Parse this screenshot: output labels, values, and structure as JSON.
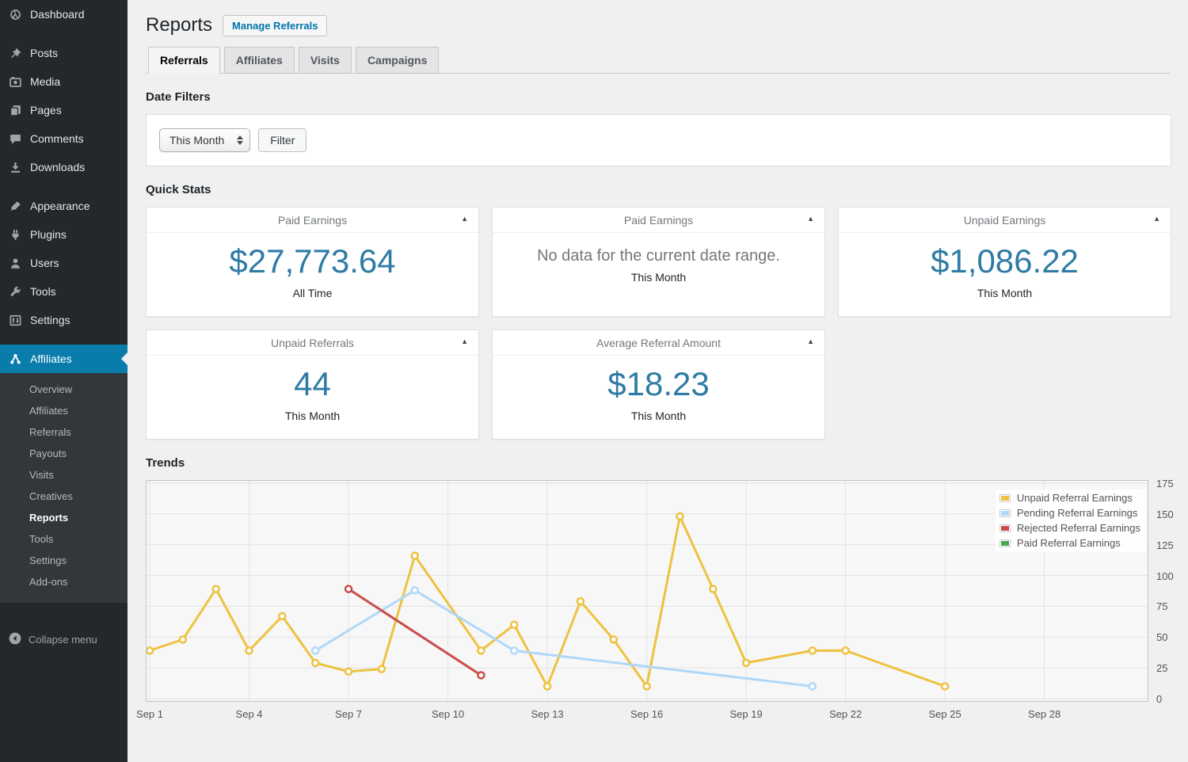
{
  "sidebar": {
    "items": [
      {
        "label": "Dashboard",
        "icon": "dashboard-icon"
      },
      {
        "label": "Posts",
        "icon": "pin-icon",
        "gap": true
      },
      {
        "label": "Media",
        "icon": "camera-icon"
      },
      {
        "label": "Pages",
        "icon": "pages-icon"
      },
      {
        "label": "Comments",
        "icon": "comment-icon"
      },
      {
        "label": "Downloads",
        "icon": "download-icon"
      },
      {
        "label": "Appearance",
        "icon": "brush-icon",
        "gap": true
      },
      {
        "label": "Plugins",
        "icon": "plug-icon"
      },
      {
        "label": "Users",
        "icon": "user-icon"
      },
      {
        "label": "Tools",
        "icon": "wrench-icon"
      },
      {
        "label": "Settings",
        "icon": "sliders-icon"
      },
      {
        "label": "Affiliates",
        "icon": "affiliates-icon",
        "gap": true,
        "active": true
      }
    ],
    "submenu": [
      "Overview",
      "Affiliates",
      "Referrals",
      "Payouts",
      "Visits",
      "Creatives",
      "Reports",
      "Tools",
      "Settings",
      "Add-ons"
    ],
    "submenu_current": "Reports",
    "collapse_label": "Collapse menu"
  },
  "header": {
    "title": "Reports",
    "action_label": "Manage Referrals"
  },
  "tabs": [
    {
      "label": "Referrals",
      "active": true
    },
    {
      "label": "Affiliates"
    },
    {
      "label": "Visits"
    },
    {
      "label": "Campaigns"
    }
  ],
  "date_filters": {
    "heading": "Date Filters",
    "select_value": "This Month",
    "filter_label": "Filter"
  },
  "quick_stats": {
    "heading": "Quick Stats",
    "cards": [
      {
        "title": "Paid Earnings",
        "value": "$27,773.64",
        "period": "All Time"
      },
      {
        "title": "Paid Earnings",
        "no_data": "No data for the current date range.",
        "period": "This Month"
      },
      {
        "title": "Unpaid Earnings",
        "value": "$1,086.22",
        "period": "This Month"
      },
      {
        "title": "Unpaid Referrals",
        "value": "44",
        "period": "This Month"
      },
      {
        "title": "Average Referral Amount",
        "value": "$18.23",
        "period": "This Month"
      }
    ]
  },
  "trends": {
    "heading": "Trends"
  },
  "chart_data": {
    "type": "line",
    "title": "Trends",
    "x_tick_labels": [
      "Sep 1",
      "Sep 4",
      "Sep 7",
      "Sep 10",
      "Sep 13",
      "Sep 16",
      "Sep 19",
      "Sep 22",
      "Sep 25",
      "Sep 28"
    ],
    "x_tick_days": [
      1,
      4,
      7,
      10,
      13,
      16,
      19,
      22,
      25,
      28
    ],
    "x_range": [
      0.88,
      31.14
    ],
    "y_ticks": [
      0,
      25,
      50,
      75,
      100,
      125,
      150,
      175
    ],
    "y_range": [
      0,
      177.5
    ],
    "grid": true,
    "legend_position": "top-right",
    "series": [
      {
        "name": "Unpaid Referral Earnings",
        "color": "#edc240",
        "points": [
          [
            1,
            39
          ],
          [
            2,
            48
          ],
          [
            3,
            89
          ],
          [
            4,
            39
          ],
          [
            5,
            67
          ],
          [
            6,
            29
          ],
          [
            7,
            22
          ],
          [
            8,
            24
          ],
          [
            9,
            116
          ],
          [
            11,
            39
          ],
          [
            12,
            60
          ],
          [
            13,
            10
          ],
          [
            14,
            79
          ],
          [
            15,
            48
          ],
          [
            16,
            10
          ],
          [
            17,
            148
          ],
          [
            18,
            89
          ],
          [
            19,
            29
          ],
          [
            21,
            39
          ],
          [
            22,
            39
          ],
          [
            25,
            10
          ]
        ]
      },
      {
        "name": "Pending Referral Earnings",
        "color": "#afd8f8",
        "points": [
          [
            6,
            39
          ],
          [
            9,
            88
          ],
          [
            12,
            39
          ],
          [
            21,
            10
          ]
        ]
      },
      {
        "name": "Rejected Referral Earnings",
        "color": "#cb4b4b",
        "points": [
          [
            7,
            89
          ],
          [
            11,
            19
          ]
        ]
      },
      {
        "name": "Paid Referral Earnings",
        "color": "#4da74d",
        "points": []
      }
    ]
  },
  "colors": {
    "menu_highlight": "#0a7cab",
    "stat_value": "#2e7ba4",
    "link": "#0073aa",
    "chart_grid": "#e3e3e3",
    "chart_border": "#c3c4c7",
    "chart_bg": "#f7f7f7"
  }
}
